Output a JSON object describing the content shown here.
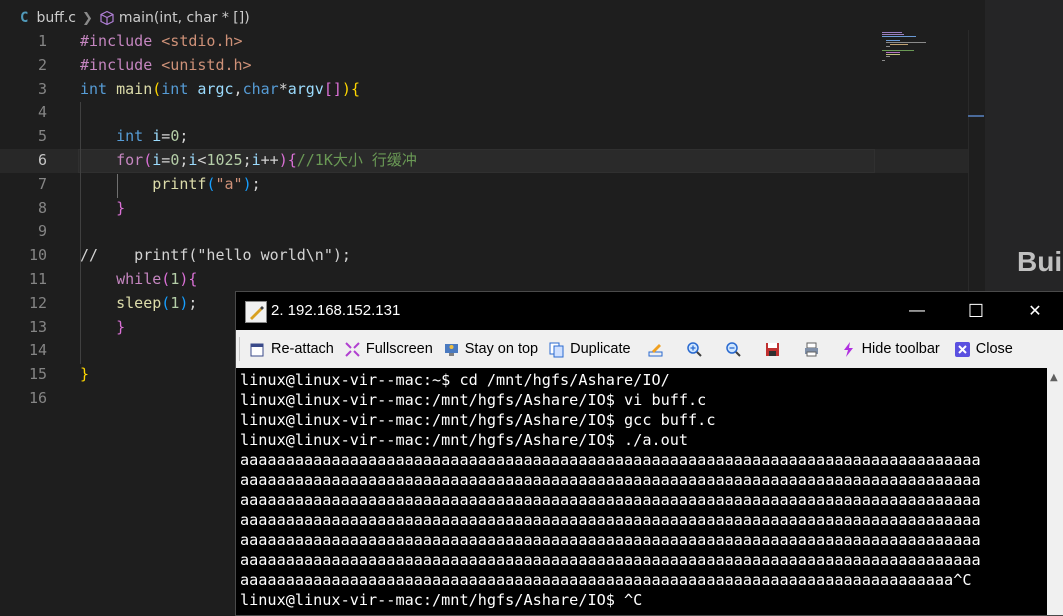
{
  "breadcrumb": {
    "lang_icon": "C",
    "file": "buff.c",
    "symbol": "main(int, char * [])"
  },
  "code": {
    "line_numbers": [
      "1",
      "2",
      "3",
      "4",
      "5",
      "6",
      "7",
      "8",
      "9",
      "10",
      "11",
      "12",
      "13",
      "14",
      "15",
      "16"
    ],
    "current_line": 6,
    "lines": {
      "l1": {
        "kw": "#include",
        "inc": "<stdio.h>"
      },
      "l2": {
        "kw": "#include",
        "inc": "<unistd.h>"
      },
      "l3": {
        "t1": "int",
        "t2": "main",
        "t3": "(",
        "t4": "int",
        "t5": "argc",
        "t6": ",",
        "t7": "char",
        "t8": "*",
        "t9": "argv",
        "t10": "[]",
        "t11": ")",
        "t12": "{"
      },
      "l5": {
        "t1": "int",
        "t2": "i",
        "t3": "=",
        "t4": "0",
        "t5": ";"
      },
      "l6": {
        "t1": "for",
        "t2": "(",
        "t3": "i",
        "t4": "=",
        "t5": "0",
        "t6": ";",
        "t7": "i",
        "t8": "<",
        "t9": "1025",
        "t10": ";",
        "t11": "i",
        "t12": "++",
        "t13": ")",
        "t14": "{",
        "t15": "//1K大小 行缓冲"
      },
      "l7": {
        "t1": "printf",
        "t2": "(",
        "t3": "\"a\"",
        "t4": ")",
        "t5": ";"
      },
      "l8": {
        "t1": "}"
      },
      "l10": {
        "t1": "//    printf(\"hello world\\n\");"
      },
      "l11": {
        "t1": "while",
        "t2": "(",
        "t3": "1",
        "t4": ")",
        "t5": "{"
      },
      "l12": {
        "t1": "sleep",
        "t2": "(",
        "t3": "1",
        "t4": ")",
        "t5": ";"
      },
      "l13": {
        "t1": "}"
      },
      "l15": {
        "t1": "}"
      }
    }
  },
  "right_panel": {
    "text": "Bui"
  },
  "terminal": {
    "title": "2. 192.168.152.131",
    "window_controls": {
      "minimize": "—",
      "maximize": "☐",
      "close": "✕"
    },
    "toolbar": {
      "reattach": "Re-attach",
      "fullscreen": "Fullscreen",
      "stay_on_top": "Stay on top",
      "duplicate": "Duplicate",
      "hide_toolbar": "Hide toolbar",
      "close": "Close"
    },
    "lines": [
      "linux@linux-vir--mac:~$ cd /mnt/hgfs/Ashare/IO/",
      "linux@linux-vir--mac:/mnt/hgfs/Ashare/IO$ vi buff.c",
      "linux@linux-vir--mac:/mnt/hgfs/Ashare/IO$ gcc buff.c",
      "linux@linux-vir--mac:/mnt/hgfs/Ashare/IO$ ./a.out",
      "aaaaaaaaaaaaaaaaaaaaaaaaaaaaaaaaaaaaaaaaaaaaaaaaaaaaaaaaaaaaaaaaaaaaaaaaaaaaaaaaa",
      "aaaaaaaaaaaaaaaaaaaaaaaaaaaaaaaaaaaaaaaaaaaaaaaaaaaaaaaaaaaaaaaaaaaaaaaaaaaaaaaaa",
      "aaaaaaaaaaaaaaaaaaaaaaaaaaaaaaaaaaaaaaaaaaaaaaaaaaaaaaaaaaaaaaaaaaaaaaaaaaaaaaaaa",
      "aaaaaaaaaaaaaaaaaaaaaaaaaaaaaaaaaaaaaaaaaaaaaaaaaaaaaaaaaaaaaaaaaaaaaaaaaaaaaaaaa",
      "aaaaaaaaaaaaaaaaaaaaaaaaaaaaaaaaaaaaaaaaaaaaaaaaaaaaaaaaaaaaaaaaaaaaaaaaaaaaaaaaa",
      "aaaaaaaaaaaaaaaaaaaaaaaaaaaaaaaaaaaaaaaaaaaaaaaaaaaaaaaaaaaaaaaaaaaaaaaaaaaaaaaaa",
      "aaaaaaaaaaaaaaaaaaaaaaaaaaaaaaaaaaaaaaaaaaaaaaaaaaaaaaaaaaaaaaaaaaaaaaaaaaaaaa^C",
      "linux@linux-vir--mac:/mnt/hgfs/Ashare/IO$ ^C"
    ]
  },
  "icons": [
    "c-language-icon",
    "chevron-right-icon",
    "symbol-method-icon",
    "terminal-app-icon",
    "reattach-icon",
    "fullscreen-icon",
    "stay-on-top-icon",
    "duplicate-icon",
    "edit-icon",
    "zoom-in-icon",
    "zoom-out-icon",
    "save-icon",
    "print-icon",
    "hide-toolbar-icon",
    "close-icon"
  ]
}
